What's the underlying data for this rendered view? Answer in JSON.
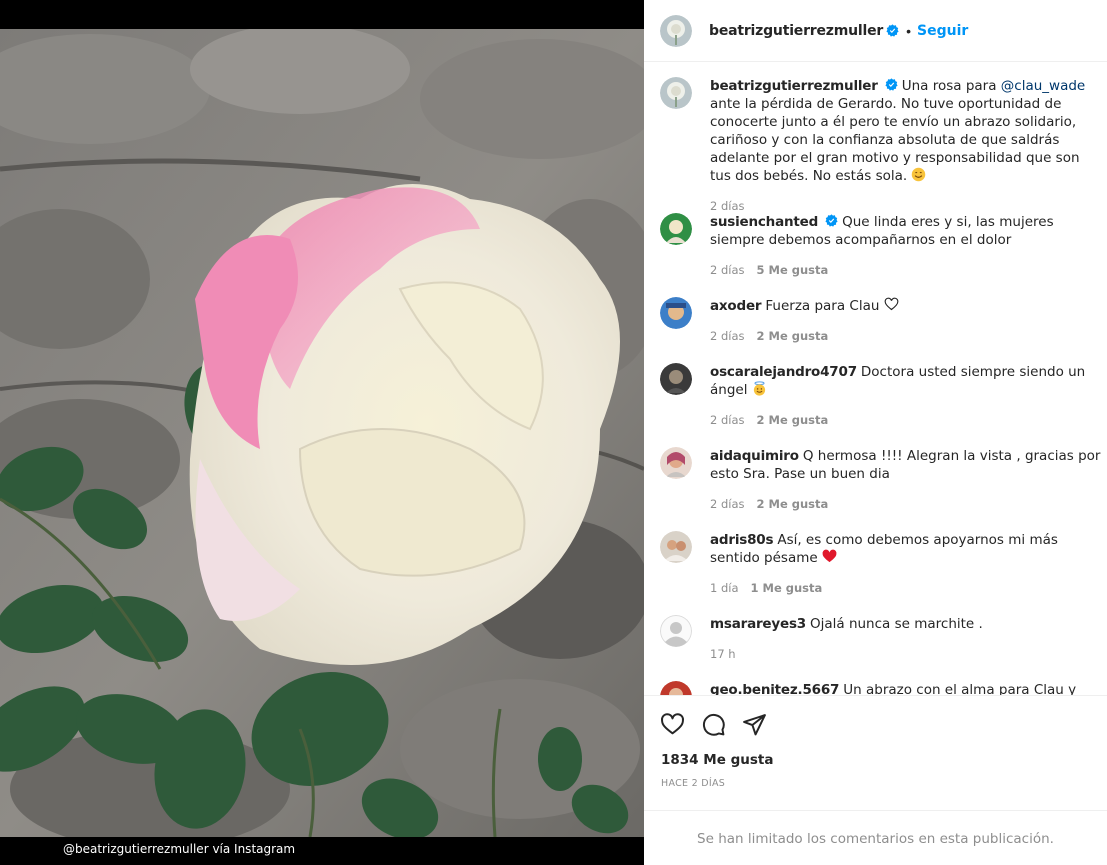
{
  "photo": {
    "credit": "@beatrizgutierrezmuller vía Instagram"
  },
  "header": {
    "username": "beatrizgutierrezmuller",
    "separator": "•",
    "follow_label": "Seguir"
  },
  "caption": {
    "username": "beatrizgutierrezmuller",
    "text_before_mention": "Una rosa para ",
    "mention": "@clau_wade",
    "text_after_mention": " ante la pérdida de Gerardo. No tuve oportunidad de conocerte junto a él pero te envío un abrazo solidario, cariñoso y con la confianza absoluta de que saldrás adelante por el gran motivo y responsabilidad que son tus dos bebés. No estás sola. ",
    "time": "2 días"
  },
  "comments": [
    {
      "username": "susienchanted",
      "verified": true,
      "text": "Que linda eres y si, las mujeres siempre debemos acompañarnos en el dolor",
      "time": "2 días",
      "likes": "5 Me gusta"
    },
    {
      "username": "axoder",
      "text": "Fuerza para Clau ",
      "time": "2 días",
      "likes": "2 Me gusta"
    },
    {
      "username": "oscaralejandro4707",
      "text": "Doctora usted siempre siendo un ángel ",
      "time": "2 días",
      "likes": "2 Me gusta"
    },
    {
      "username": "aidaquimiro",
      "text": "Q hermosa !!!! Alegran la vista , gracias por esto Sra. Pase un buen dia",
      "time": "2 días",
      "likes": "2 Me gusta"
    },
    {
      "username": "adris80s",
      "text": "Así, es como debemos apoyarnos mi más sentido pésame ",
      "time": "1 día",
      "likes": "1 Me gusta"
    },
    {
      "username": "msarareyes3",
      "text": "Ojalá nunca se marchite .",
      "time": "17 h",
      "likes": ""
    },
    {
      "username": "geo.benitez.5667",
      "text": "Un abrazo con el alma para Clau y para",
      "time": "",
      "likes": ""
    }
  ],
  "actions": {
    "like_count": "1834 Me gusta",
    "post_date": "HACE 2 DÍAS",
    "limited_notice": "Se han limitado los comentarios en esta publicación."
  },
  "colors": {
    "link_blue": "#0095f6",
    "mention": "#00376b",
    "muted": "#8e8e8e",
    "border": "#efefef"
  },
  "icons": [
    "verified-badge-icon",
    "heart-icon",
    "comment-icon",
    "share-icon",
    "emoji-smile-icon",
    "emoji-angel-icon",
    "emoji-red-heart-icon",
    "outline-heart-icon",
    "default-avatar-icon"
  ]
}
